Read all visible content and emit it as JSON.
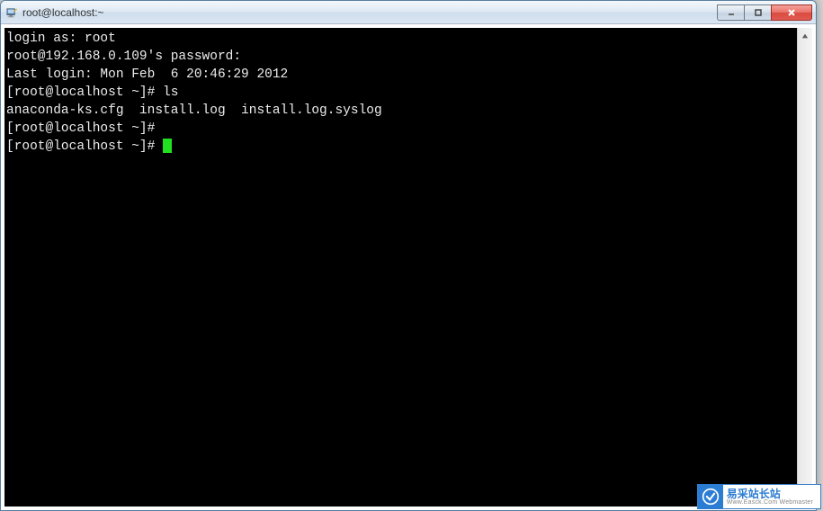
{
  "window": {
    "title": "root@localhost:~"
  },
  "terminal": {
    "lines": [
      "login as: root",
      "root@192.168.0.109's password:",
      "Last login: Mon Feb  6 20:46:29 2012",
      "[root@localhost ~]# ls",
      "anaconda-ks.cfg  install.log  install.log.syslog",
      "[root@localhost ~]#",
      "[root@localhost ~]# "
    ]
  },
  "watermark": {
    "main": "易采站长站",
    "sub": "Www.Easck.Com Webmaster"
  }
}
